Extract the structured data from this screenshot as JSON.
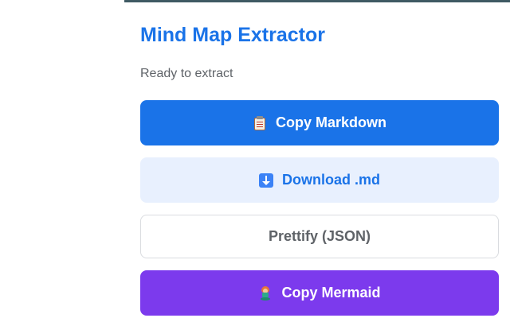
{
  "popup": {
    "title": "Mind Map Extractor",
    "status": "Ready to extract"
  },
  "buttons": {
    "copy_markdown": {
      "label": "Copy Markdown",
      "icon": "clipboard-icon"
    },
    "download_md": {
      "label": "Download .md",
      "icon": "down-arrow-icon"
    },
    "prettify_json": {
      "label": "Prettify (JSON)"
    },
    "copy_mermaid": {
      "label": "Copy Mermaid",
      "icon": "mermaid-icon"
    }
  },
  "colors": {
    "accent": "#1a73e8",
    "accent_light": "#e8f0fe",
    "mermaid": "#7c3aed",
    "text_muted": "#5f6368",
    "border": "#dadce0"
  }
}
